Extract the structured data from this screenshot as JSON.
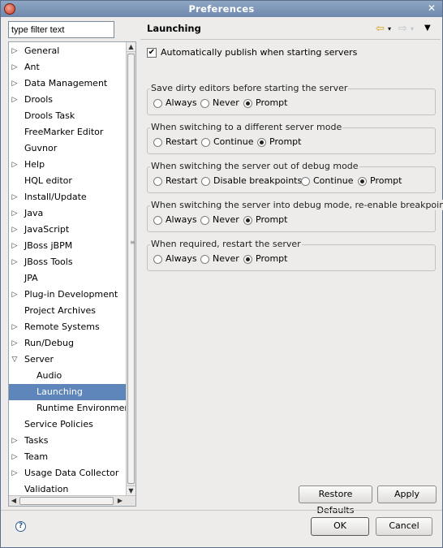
{
  "window": {
    "title": "Preferences"
  },
  "filter": {
    "value": "type filter text"
  },
  "tree": [
    {
      "label": "General",
      "expander": "collapsed",
      "depth": 0
    },
    {
      "label": "Ant",
      "expander": "collapsed",
      "depth": 0
    },
    {
      "label": "Data Management",
      "expander": "collapsed",
      "depth": 0
    },
    {
      "label": "Drools",
      "expander": "collapsed",
      "depth": 0
    },
    {
      "label": "Drools Task",
      "expander": "none",
      "depth": 0
    },
    {
      "label": "FreeMarker Editor",
      "expander": "none",
      "depth": 0
    },
    {
      "label": "Guvnor",
      "expander": "none",
      "depth": 0
    },
    {
      "label": "Help",
      "expander": "collapsed",
      "depth": 0
    },
    {
      "label": "HQL editor",
      "expander": "none",
      "depth": 0
    },
    {
      "label": "Install/Update",
      "expander": "collapsed",
      "depth": 0
    },
    {
      "label": "Java",
      "expander": "collapsed",
      "depth": 0
    },
    {
      "label": "JavaScript",
      "expander": "collapsed",
      "depth": 0
    },
    {
      "label": "JBoss jBPM",
      "expander": "collapsed",
      "depth": 0
    },
    {
      "label": "JBoss Tools",
      "expander": "collapsed",
      "depth": 0
    },
    {
      "label": "JPA",
      "expander": "none",
      "depth": 0
    },
    {
      "label": "Plug-in Development",
      "expander": "collapsed",
      "depth": 0
    },
    {
      "label": "Project Archives",
      "expander": "none",
      "depth": 0
    },
    {
      "label": "Remote Systems",
      "expander": "collapsed",
      "depth": 0
    },
    {
      "label": "Run/Debug",
      "expander": "collapsed",
      "depth": 0
    },
    {
      "label": "Server",
      "expander": "expanded",
      "depth": 0
    },
    {
      "label": "Audio",
      "expander": "none",
      "depth": 1
    },
    {
      "label": "Launching",
      "expander": "none",
      "depth": 1,
      "selected": true
    },
    {
      "label": "Runtime Environment",
      "expander": "none",
      "depth": 1
    },
    {
      "label": "Service Policies",
      "expander": "none",
      "depth": 0
    },
    {
      "label": "Tasks",
      "expander": "collapsed",
      "depth": 0
    },
    {
      "label": "Team",
      "expander": "collapsed",
      "depth": 0
    },
    {
      "label": "Usage Data Collector",
      "expander": "collapsed",
      "depth": 0
    },
    {
      "label": "Validation",
      "expander": "none",
      "depth": 0
    }
  ],
  "page": {
    "title": "Launching",
    "auto_publish": {
      "label": "Automatically publish when starting servers",
      "checked": true
    },
    "groups": [
      {
        "legend": "Save dirty editors before starting the server",
        "options": [
          "Always",
          "Never",
          "Prompt"
        ],
        "selected": "Prompt"
      },
      {
        "legend": "When switching to a different server mode",
        "options": [
          "Restart",
          "Continue",
          "Prompt"
        ],
        "selected": "Prompt"
      },
      {
        "legend": "When switching the server out of debug mode",
        "options": [
          "Restart",
          "Disable breakpoints",
          "Continue",
          "Prompt"
        ],
        "selected": "Prompt"
      },
      {
        "legend": "When switching the server into debug mode, re-enable breakpoints",
        "options": [
          "Always",
          "Never",
          "Prompt"
        ],
        "selected": "Prompt"
      },
      {
        "legend": "When required, restart the server",
        "options": [
          "Always",
          "Never",
          "Prompt"
        ],
        "selected": "Prompt"
      }
    ],
    "restore_defaults": "Restore Defaults",
    "apply": "Apply"
  },
  "footer": {
    "ok": "OK",
    "cancel": "Cancel"
  },
  "icons": {
    "back": "back-arrow-icon",
    "forward": "forward-arrow-icon",
    "menu": "view-menu-icon",
    "help": "help-icon"
  }
}
